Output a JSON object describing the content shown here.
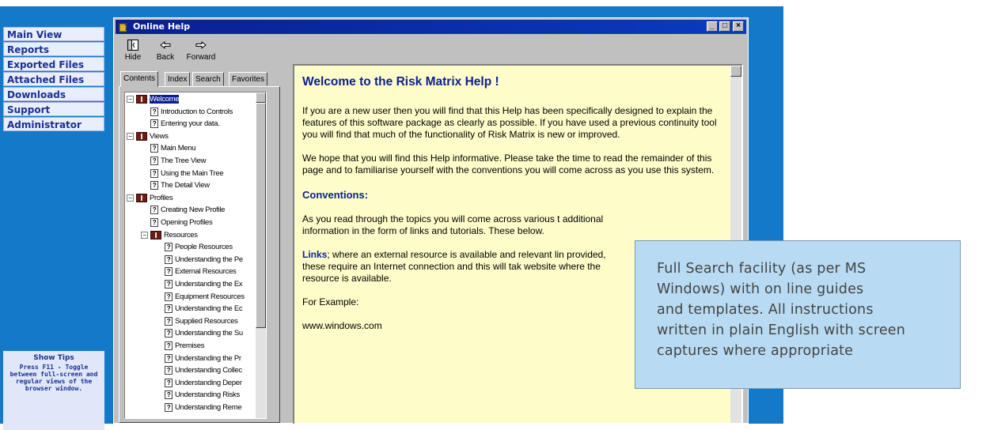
{
  "nav": {
    "items": [
      "Main View",
      "Reports",
      "Exported Files",
      "Attached Files",
      "Downloads",
      "Support",
      "Administrator"
    ],
    "tips_title": "Show Tips",
    "tips_text": "Press F11 - Toggle between full-screen and regular views of the browser window."
  },
  "window": {
    "title": "Online Help",
    "icon": "help-book-icon",
    "controls": {
      "minimize": "_",
      "maximize": "□",
      "close": "×"
    }
  },
  "toolbar": {
    "hide": "Hide",
    "back": "Back",
    "forward": "Forward"
  },
  "tabs": {
    "contents": "Contents",
    "index": "Index",
    "search": "Search",
    "favorites": "Favorites"
  },
  "tree": [
    {
      "label": "Welcome",
      "type": "book",
      "level": 0,
      "selected": true
    },
    {
      "label": "Introduction to Controls",
      "type": "page",
      "level": 1
    },
    {
      "label": "Entering your data.",
      "type": "page",
      "level": 1
    },
    {
      "label": "Views",
      "type": "book",
      "level": 0
    },
    {
      "label": "Main Menu",
      "type": "page",
      "level": 1
    },
    {
      "label": "The Tree View",
      "type": "page",
      "level": 1
    },
    {
      "label": "Using the Main Tree",
      "type": "page",
      "level": 1
    },
    {
      "label": "The Detail View",
      "type": "page",
      "level": 1
    },
    {
      "label": "Profiles",
      "type": "book",
      "level": 0
    },
    {
      "label": "Creating New Profile",
      "type": "page",
      "level": 1
    },
    {
      "label": "Opening Profiles",
      "type": "page",
      "level": 1
    },
    {
      "label": "Resources",
      "type": "book",
      "level": 1
    },
    {
      "label": "People Resources",
      "type": "page",
      "level": 2
    },
    {
      "label": "Understanding the Pe",
      "type": "page",
      "level": 2
    },
    {
      "label": "External Resources",
      "type": "page",
      "level": 2
    },
    {
      "label": "Understanding the Ex",
      "type": "page",
      "level": 2
    },
    {
      "label": "Equipment Resources",
      "type": "page",
      "level": 2
    },
    {
      "label": "Understanding the Ec",
      "type": "page",
      "level": 2
    },
    {
      "label": "Supplied Resources",
      "type": "page",
      "level": 2
    },
    {
      "label": "Understanding the Su",
      "type": "page",
      "level": 2
    },
    {
      "label": "Premises",
      "type": "page",
      "level": 2
    },
    {
      "label": "Understanding the Pr",
      "type": "page",
      "level": 2
    },
    {
      "label": "Understanding Collec",
      "type": "page",
      "level": 2
    },
    {
      "label": "Understanding Deper",
      "type": "page",
      "level": 2
    },
    {
      "label": "Understanding Risks",
      "type": "page",
      "level": 2
    },
    {
      "label": "Understanding Reme",
      "type": "page",
      "level": 2
    }
  ],
  "content": {
    "heading": "Welcome to the Risk Matrix Help !",
    "p1": "If you are a new user then you will find that this Help has been specifically designed to explain the features of this software package as clearly as possible. If you have used a previous continuity tool you will find that much of the functionality of Risk Matrix is new or improved.",
    "p2": "We hope that you will find this Help informative. Please take the time to read the remainder of this page and to familiarise yourself with the conventions you will come across as you use this system.",
    "conventions": "Conventions:",
    "p3": "As you read through the topics you will come across various t additional information in the form of links and tutorials. These below.",
    "links_label": "Links",
    "p4": "; where an external resource is available and relevant lin provided, these require an Internet connection and this will tak website where the resource is available.",
    "for_example": "For Example:",
    "example_link": "www.windows.com"
  },
  "callout": {
    "lines": [
      "Full Search facility (as per MS",
      "Windows) with on line guides",
      "and templates.  All instructions",
      "written in plain English with screen",
      "captures where appropriate"
    ]
  }
}
